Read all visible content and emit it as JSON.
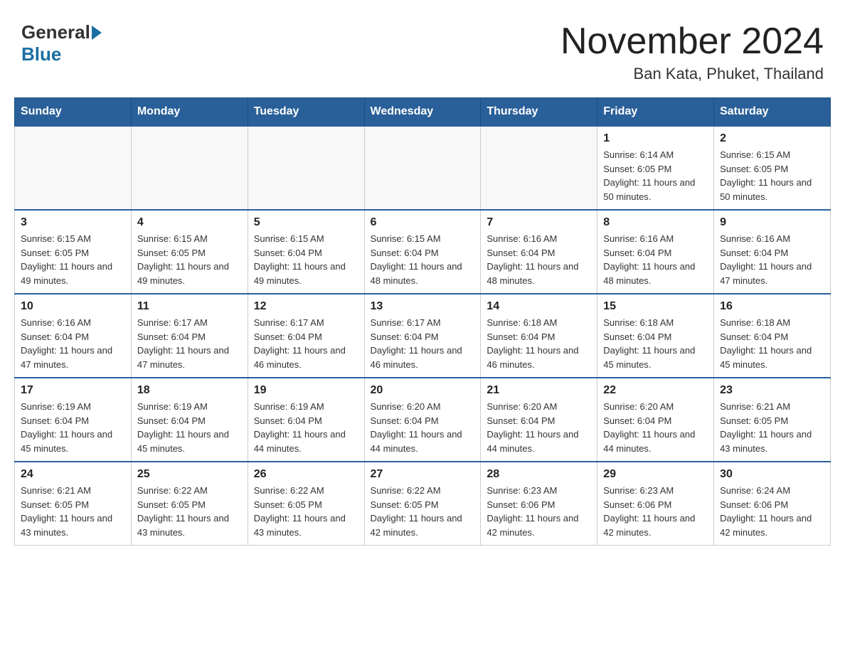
{
  "header": {
    "logo_general": "General",
    "logo_blue": "Blue",
    "month_year": "November 2024",
    "location": "Ban Kata, Phuket, Thailand"
  },
  "weekdays": [
    "Sunday",
    "Monday",
    "Tuesday",
    "Wednesday",
    "Thursday",
    "Friday",
    "Saturday"
  ],
  "weeks": [
    [
      {
        "day": "",
        "info": ""
      },
      {
        "day": "",
        "info": ""
      },
      {
        "day": "",
        "info": ""
      },
      {
        "day": "",
        "info": ""
      },
      {
        "day": "",
        "info": ""
      },
      {
        "day": "1",
        "info": "Sunrise: 6:14 AM\nSunset: 6:05 PM\nDaylight: 11 hours and 50 minutes."
      },
      {
        "day": "2",
        "info": "Sunrise: 6:15 AM\nSunset: 6:05 PM\nDaylight: 11 hours and 50 minutes."
      }
    ],
    [
      {
        "day": "3",
        "info": "Sunrise: 6:15 AM\nSunset: 6:05 PM\nDaylight: 11 hours and 49 minutes."
      },
      {
        "day": "4",
        "info": "Sunrise: 6:15 AM\nSunset: 6:05 PM\nDaylight: 11 hours and 49 minutes."
      },
      {
        "day": "5",
        "info": "Sunrise: 6:15 AM\nSunset: 6:04 PM\nDaylight: 11 hours and 49 minutes."
      },
      {
        "day": "6",
        "info": "Sunrise: 6:15 AM\nSunset: 6:04 PM\nDaylight: 11 hours and 48 minutes."
      },
      {
        "day": "7",
        "info": "Sunrise: 6:16 AM\nSunset: 6:04 PM\nDaylight: 11 hours and 48 minutes."
      },
      {
        "day": "8",
        "info": "Sunrise: 6:16 AM\nSunset: 6:04 PM\nDaylight: 11 hours and 48 minutes."
      },
      {
        "day": "9",
        "info": "Sunrise: 6:16 AM\nSunset: 6:04 PM\nDaylight: 11 hours and 47 minutes."
      }
    ],
    [
      {
        "day": "10",
        "info": "Sunrise: 6:16 AM\nSunset: 6:04 PM\nDaylight: 11 hours and 47 minutes."
      },
      {
        "day": "11",
        "info": "Sunrise: 6:17 AM\nSunset: 6:04 PM\nDaylight: 11 hours and 47 minutes."
      },
      {
        "day": "12",
        "info": "Sunrise: 6:17 AM\nSunset: 6:04 PM\nDaylight: 11 hours and 46 minutes."
      },
      {
        "day": "13",
        "info": "Sunrise: 6:17 AM\nSunset: 6:04 PM\nDaylight: 11 hours and 46 minutes."
      },
      {
        "day": "14",
        "info": "Sunrise: 6:18 AM\nSunset: 6:04 PM\nDaylight: 11 hours and 46 minutes."
      },
      {
        "day": "15",
        "info": "Sunrise: 6:18 AM\nSunset: 6:04 PM\nDaylight: 11 hours and 45 minutes."
      },
      {
        "day": "16",
        "info": "Sunrise: 6:18 AM\nSunset: 6:04 PM\nDaylight: 11 hours and 45 minutes."
      }
    ],
    [
      {
        "day": "17",
        "info": "Sunrise: 6:19 AM\nSunset: 6:04 PM\nDaylight: 11 hours and 45 minutes."
      },
      {
        "day": "18",
        "info": "Sunrise: 6:19 AM\nSunset: 6:04 PM\nDaylight: 11 hours and 45 minutes."
      },
      {
        "day": "19",
        "info": "Sunrise: 6:19 AM\nSunset: 6:04 PM\nDaylight: 11 hours and 44 minutes."
      },
      {
        "day": "20",
        "info": "Sunrise: 6:20 AM\nSunset: 6:04 PM\nDaylight: 11 hours and 44 minutes."
      },
      {
        "day": "21",
        "info": "Sunrise: 6:20 AM\nSunset: 6:04 PM\nDaylight: 11 hours and 44 minutes."
      },
      {
        "day": "22",
        "info": "Sunrise: 6:20 AM\nSunset: 6:04 PM\nDaylight: 11 hours and 44 minutes."
      },
      {
        "day": "23",
        "info": "Sunrise: 6:21 AM\nSunset: 6:05 PM\nDaylight: 11 hours and 43 minutes."
      }
    ],
    [
      {
        "day": "24",
        "info": "Sunrise: 6:21 AM\nSunset: 6:05 PM\nDaylight: 11 hours and 43 minutes."
      },
      {
        "day": "25",
        "info": "Sunrise: 6:22 AM\nSunset: 6:05 PM\nDaylight: 11 hours and 43 minutes."
      },
      {
        "day": "26",
        "info": "Sunrise: 6:22 AM\nSunset: 6:05 PM\nDaylight: 11 hours and 43 minutes."
      },
      {
        "day": "27",
        "info": "Sunrise: 6:22 AM\nSunset: 6:05 PM\nDaylight: 11 hours and 42 minutes."
      },
      {
        "day": "28",
        "info": "Sunrise: 6:23 AM\nSunset: 6:06 PM\nDaylight: 11 hours and 42 minutes."
      },
      {
        "day": "29",
        "info": "Sunrise: 6:23 AM\nSunset: 6:06 PM\nDaylight: 11 hours and 42 minutes."
      },
      {
        "day": "30",
        "info": "Sunrise: 6:24 AM\nSunset: 6:06 PM\nDaylight: 11 hours and 42 minutes."
      }
    ]
  ]
}
